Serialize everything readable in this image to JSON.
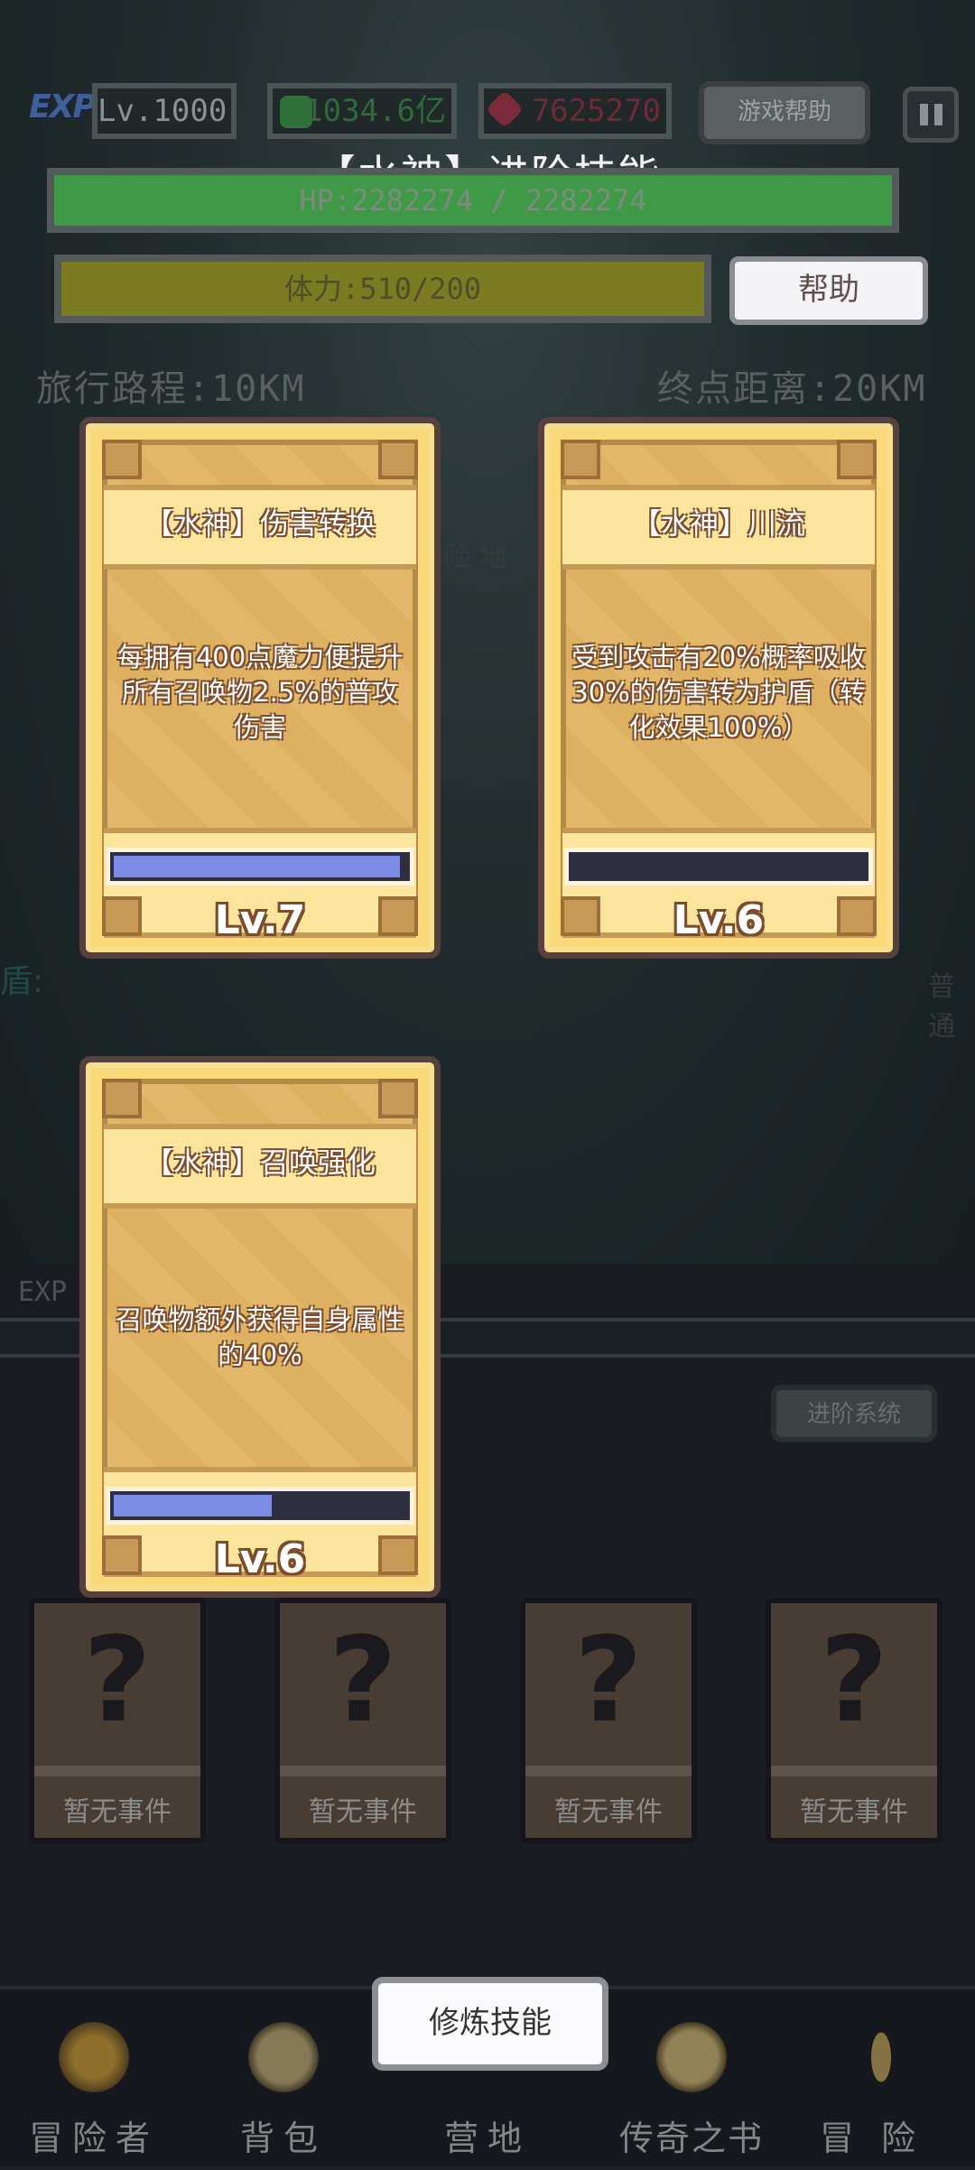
{
  "top": {
    "exp_label": "EXP",
    "level": "Lv.1000",
    "gold": "1034.6亿",
    "gems": "7625270",
    "game_help": "游戏帮助"
  },
  "dialog": {
    "title": "【水神】进阶技能",
    "hp_text": "HP:2282274 / 2282274",
    "hp_fraction": 1.0,
    "stamina_text": "体力:510/200",
    "stamina_fraction": 1.0,
    "help": "帮助"
  },
  "travel": {
    "distance": "旅行路程:10KM",
    "remaining": "终点距离:20KM"
  },
  "background_fragments": {
    "place": "险 地",
    "shield": "盾:",
    "attack": "普通"
  },
  "skills": [
    {
      "name": "【水神】伤害转换",
      "desc": "每拥有400点魔力便提升所有召唤物2.5%的普攻伤害",
      "level": "Lv.7",
      "progress": 0.98
    },
    {
      "name": "【水神】川流",
      "desc": "受到攻击有20%概率吸收30%的伤害转为护盾（转化效果100%）",
      "level": "Lv.6",
      "progress": 0.0
    },
    {
      "name": "【水神】召唤强化",
      "desc": "召唤物额外获得自身属性的40%",
      "level": "Lv.6",
      "progress": 0.55
    }
  ],
  "exp_bar_label": "EXP",
  "advance_system": "进阶系统",
  "events": [
    {
      "label": "暂无事件"
    },
    {
      "label": "暂无事件"
    },
    {
      "label": "暂无事件"
    },
    {
      "label": "暂无事件"
    }
  ],
  "train_button": "修炼技能",
  "nav": [
    {
      "label": "冒险者",
      "icon": "crown-icon"
    },
    {
      "label": "背包",
      "icon": "backpack-icon"
    },
    {
      "label": "营地",
      "icon": "camp-icon"
    },
    {
      "label": "传奇之书",
      "icon": "book-icon"
    },
    {
      "label": "冒险",
      "icon": "sword-icon"
    }
  ],
  "colors": {
    "hp": "#3f9a48",
    "stamina": "#8a8a20",
    "card": "#f9d979",
    "progress": "#7d8ce4"
  }
}
